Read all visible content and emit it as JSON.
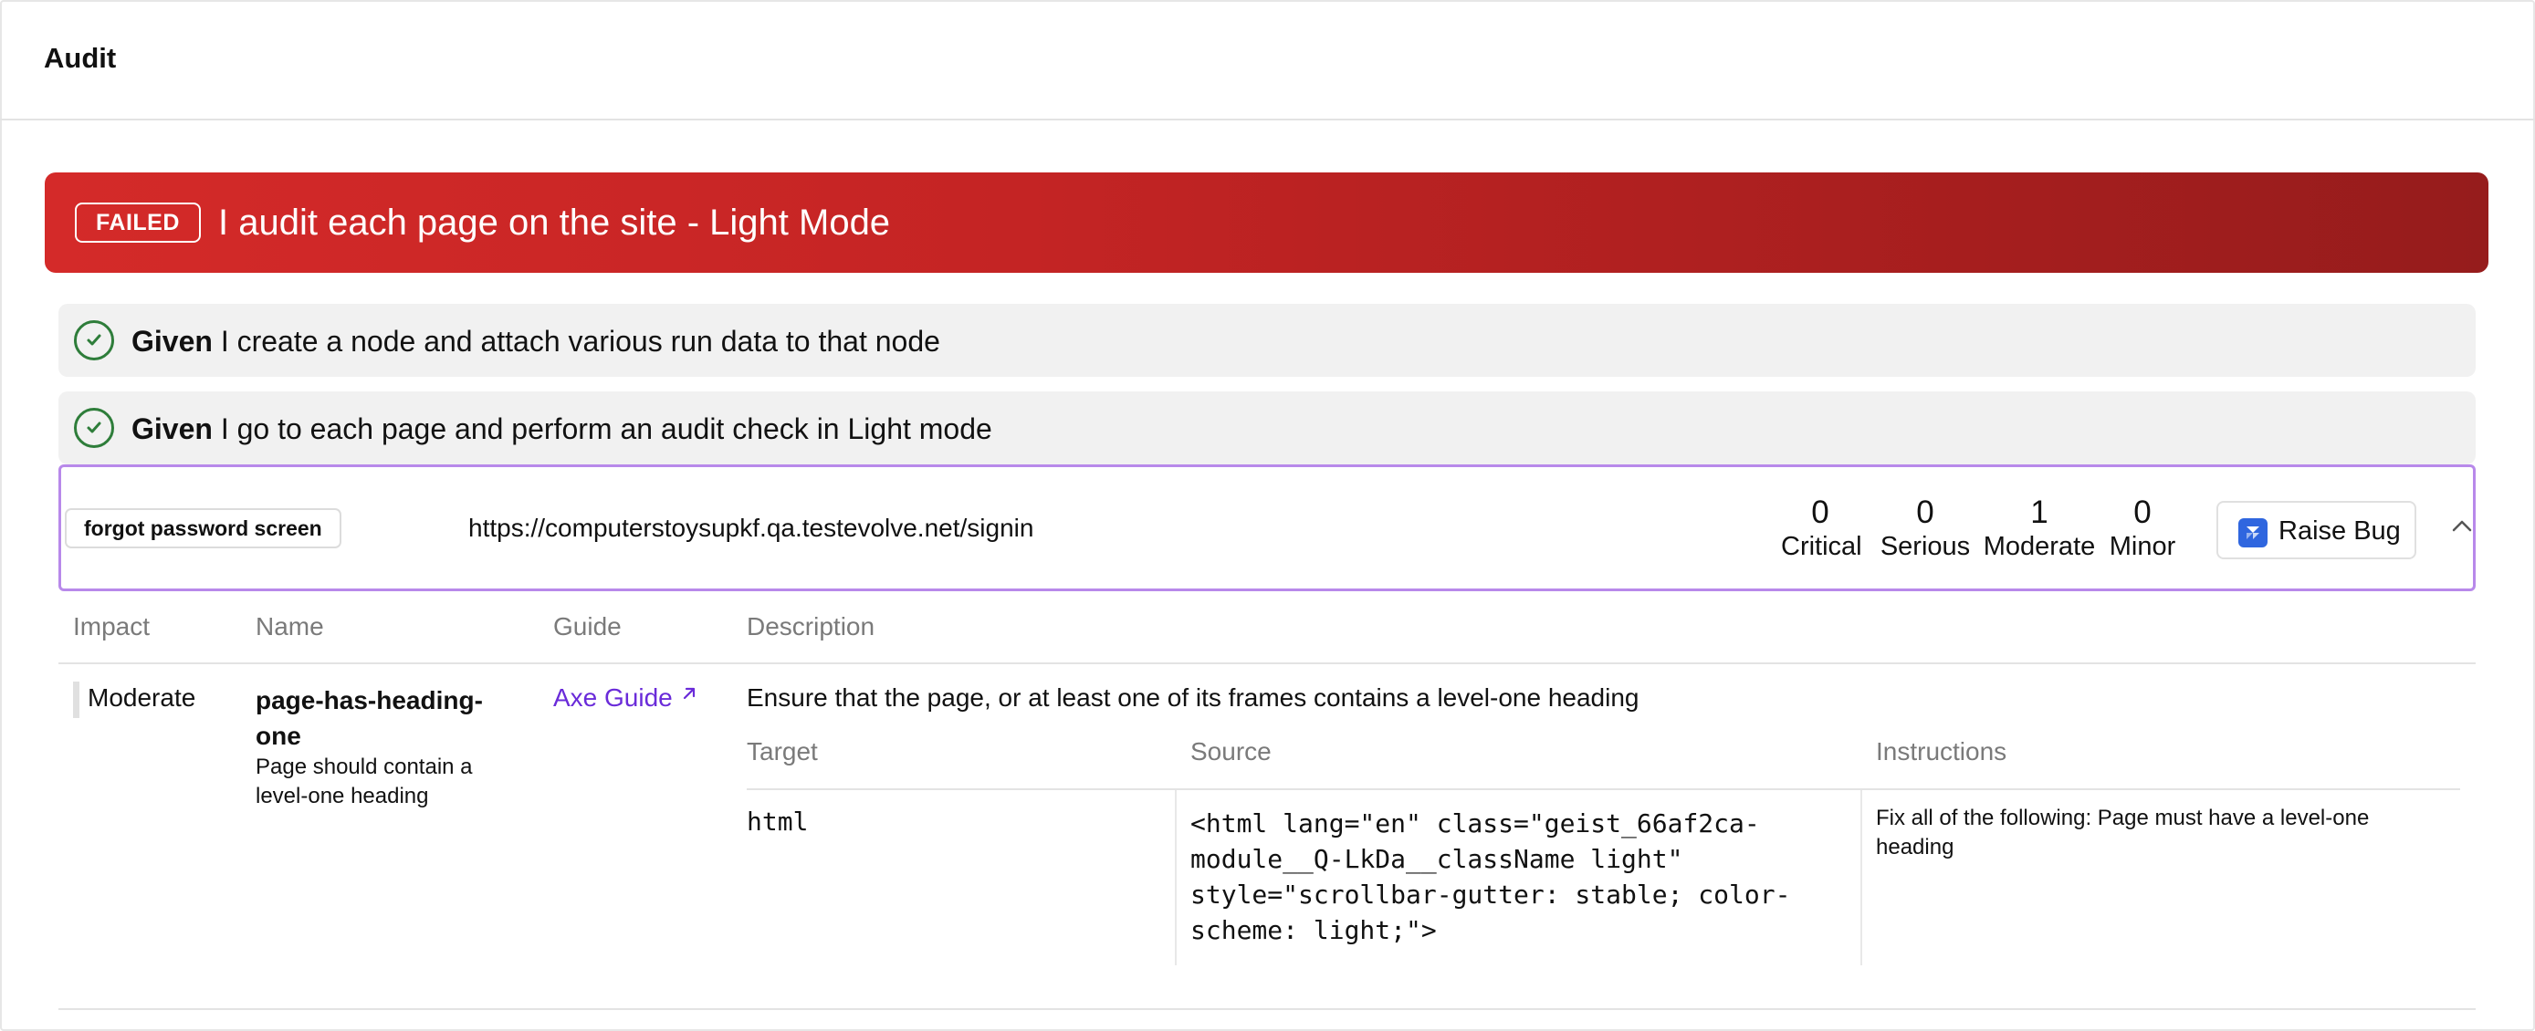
{
  "header": {
    "title": "Audit"
  },
  "scenario": {
    "status": "FAILED",
    "title": "I audit each page on the site - Light Mode",
    "status_color": "#d42a29"
  },
  "steps": [
    {
      "keyword": "Given",
      "text": "I create a node and attach various run data to that node",
      "icon": "check-circle-icon"
    },
    {
      "keyword": "Given",
      "text": "I go to each page and perform an audit check in Light mode",
      "icon": "check-circle-icon"
    }
  ],
  "page_result": {
    "tag": "forgot password screen",
    "url": "https://computerstoysupkf.qa.testevolve.net/signin",
    "counts": {
      "critical": {
        "value": "0",
        "label": "Critical"
      },
      "serious": {
        "value": "0",
        "label": "Serious"
      },
      "moderate": {
        "value": "1",
        "label": "Moderate"
      },
      "minor": {
        "value": "0",
        "label": "Minor"
      }
    },
    "raise_bug_label": "Raise Bug",
    "raise_bug_icon": "jira-icon",
    "highlight_color": "#b889ea"
  },
  "violations_table": {
    "headers": {
      "impact": "Impact",
      "name": "Name",
      "guide": "Guide",
      "description": "Description"
    },
    "rows": [
      {
        "impact": "Moderate",
        "name": "page-has-heading-one",
        "help": "Page should contain a level-one heading",
        "guide_label": "Axe Guide",
        "description": "Ensure that the page, or at least one of its frames contains a level-one heading",
        "nodes_headers": {
          "target": "Target",
          "source": "Source",
          "instructions": "Instructions"
        },
        "nodes": [
          {
            "target": "html",
            "source": "<html lang=\"en\" class=\"geist_66af2ca-module__Q-LkDa__className light\" style=\"scrollbar-gutter: stable; color-scheme: light;\">",
            "instructions": "Fix all of the following: Page must have a level-one heading"
          }
        ]
      }
    ]
  }
}
